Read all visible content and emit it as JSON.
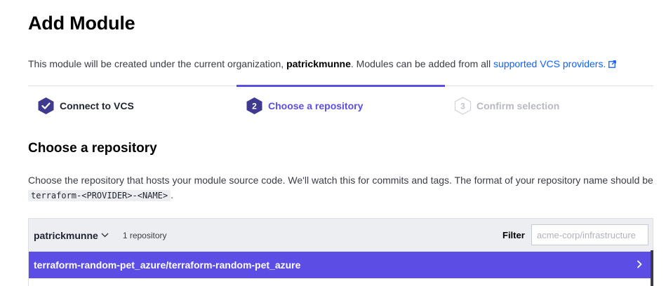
{
  "page": {
    "title": "Add Module"
  },
  "intro": {
    "prefix": "This module will be created under the current organization,",
    "org": "patrickmunne",
    "middle": ". Modules can be added from all",
    "link": "supported VCS providers.",
    "link_icon": "external-link-icon"
  },
  "steps": [
    {
      "number": "1",
      "label": "Connect to VCS",
      "state": "complete",
      "icon": "check-hexagon-icon"
    },
    {
      "number": "2",
      "label": "Choose a repository",
      "state": "active"
    },
    {
      "number": "3",
      "label": "Confirm selection",
      "state": "upcoming"
    }
  ],
  "section": {
    "title": "Choose a repository",
    "desc_line1": "Choose the repository that hosts your module source code. We'll watch this for commits and tags. The format of your repository name should",
    "desc_be": "be",
    "desc_code": "terraform-<PROVIDER>-<NAME>",
    "desc_end": "."
  },
  "repos": {
    "org": "patrickmunne",
    "count": "1 repository",
    "filter_label": "Filter",
    "filter_placeholder": "acme-corp/infrastructure",
    "items": [
      {
        "name": "terraform-random-pet_azure/terraform-random-pet_azure"
      }
    ]
  },
  "colors": {
    "accent": "#5c4ee5",
    "link": "#1060ff",
    "header_bg": "#eceef2"
  }
}
